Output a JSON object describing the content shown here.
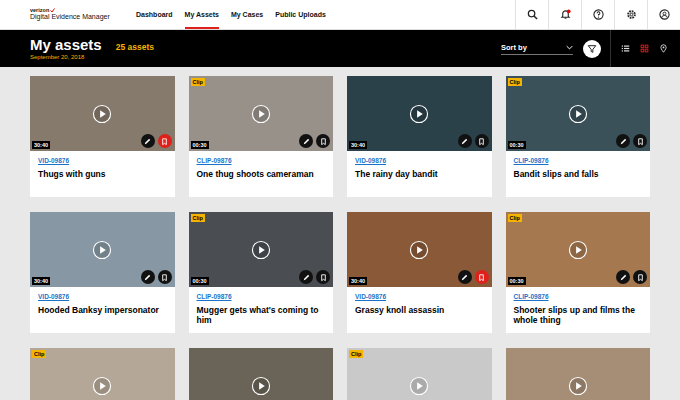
{
  "app": {
    "brand": "verizon",
    "title": "Digital Evidence Manager"
  },
  "nav": [
    {
      "label": "Dashboard",
      "selected": false
    },
    {
      "label": "My Assets",
      "selected": true
    },
    {
      "label": "My Cases",
      "selected": false
    },
    {
      "label": "Public Uploads",
      "selected": false
    }
  ],
  "notifications": {
    "unread": true
  },
  "header": {
    "title": "My assets",
    "count": "25 assets",
    "date": "September 20, 2018",
    "sort_label": "Sort by"
  },
  "views": [
    {
      "kind": "list",
      "selected": false
    },
    {
      "kind": "grid",
      "selected": true
    },
    {
      "kind": "map",
      "selected": false
    }
  ],
  "assets": [
    {
      "id": "VID-09876",
      "title": "Thugs with guns",
      "duration": "30:40",
      "badge": null,
      "bookmarked": true,
      "color": "#857a6c"
    },
    {
      "id": "CLIP-09876",
      "title": "One thug shoots cameraman",
      "duration": "00:30",
      "badge": "Clip",
      "bookmarked": false,
      "color": "#97918a"
    },
    {
      "id": "VID-09876",
      "title": "The rainy day bandit",
      "duration": "30:40",
      "badge": null,
      "bookmarked": false,
      "color": "#2b4149"
    },
    {
      "id": "CLIP-09876",
      "title": "Bandit slips and falls",
      "duration": "00:30",
      "badge": "Clip",
      "bookmarked": false,
      "color": "#3b5159"
    },
    {
      "id": "VID-09876",
      "title": "Hooded Banksy impersonator",
      "duration": "30:40",
      "badge": null,
      "bookmarked": false,
      "color": "#8797a3"
    },
    {
      "id": "CLIP-09876",
      "title": "Mugger gets what's coming to him",
      "duration": "00:30",
      "badge": "Clip",
      "bookmarked": false,
      "color": "#4a4e53"
    },
    {
      "id": "VID-09876",
      "title": "Grassy knoll assassin",
      "duration": "30:40",
      "badge": null,
      "bookmarked": true,
      "color": "#8a5a38"
    },
    {
      "id": "CLIP-09876",
      "title": "Shooter slips up and films the whole thing",
      "duration": "00:30",
      "badge": "Clip",
      "bookmarked": false,
      "color": "#a67850"
    },
    {
      "id": null,
      "title": null,
      "duration": null,
      "badge": "Clip",
      "bookmarked": false,
      "color": "#b5a797"
    },
    {
      "id": null,
      "title": null,
      "duration": null,
      "badge": null,
      "bookmarked": false,
      "color": "#6a6458"
    },
    {
      "id": null,
      "title": null,
      "duration": null,
      "badge": "Clip",
      "bookmarked": false,
      "color": "#c9c9c9"
    },
    {
      "id": null,
      "title": null,
      "duration": null,
      "badge": null,
      "bookmarked": false,
      "color": "#a68e76"
    }
  ]
}
